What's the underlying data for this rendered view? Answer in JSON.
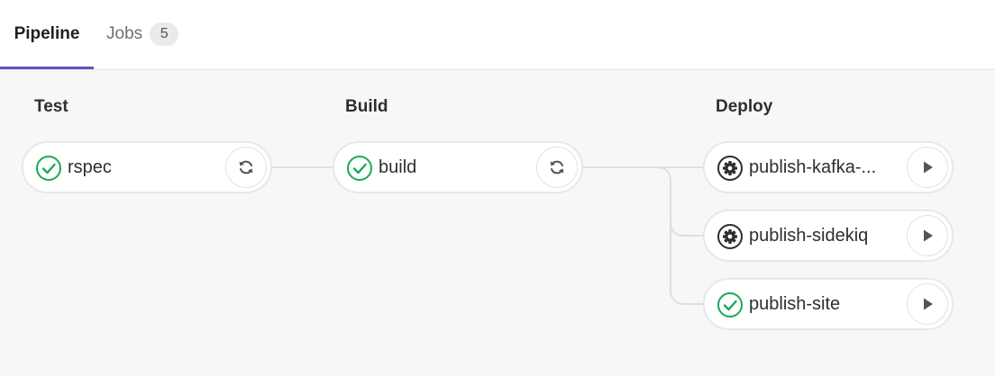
{
  "tabs": [
    {
      "label": "Pipeline",
      "active": true
    },
    {
      "label": "Jobs",
      "count": "5",
      "active": false
    }
  ],
  "stages": [
    {
      "title": "Test",
      "jobs": [
        {
          "name": "rspec",
          "status": "success",
          "status_icon": "check-circle-icon",
          "action_icon": "retry-icon"
        }
      ]
    },
    {
      "title": "Build",
      "jobs": [
        {
          "name": "build",
          "status": "success",
          "status_icon": "check-circle-icon",
          "action_icon": "retry-icon"
        }
      ]
    },
    {
      "title": "Deploy",
      "jobs": [
        {
          "name": "publish-kafka-...",
          "status": "manual",
          "status_icon": "gear-icon",
          "action_icon": "play-icon"
        },
        {
          "name": "publish-sidekiq",
          "status": "manual",
          "status_icon": "gear-icon",
          "action_icon": "play-icon"
        },
        {
          "name": "publish-site",
          "status": "success",
          "status_icon": "check-circle-icon",
          "action_icon": "play-icon"
        }
      ]
    }
  ],
  "colors": {
    "accent": "#6b4fbb",
    "success": "#1aaa55",
    "manual": "#2e2e2e",
    "connector": "#dfdfdf"
  }
}
